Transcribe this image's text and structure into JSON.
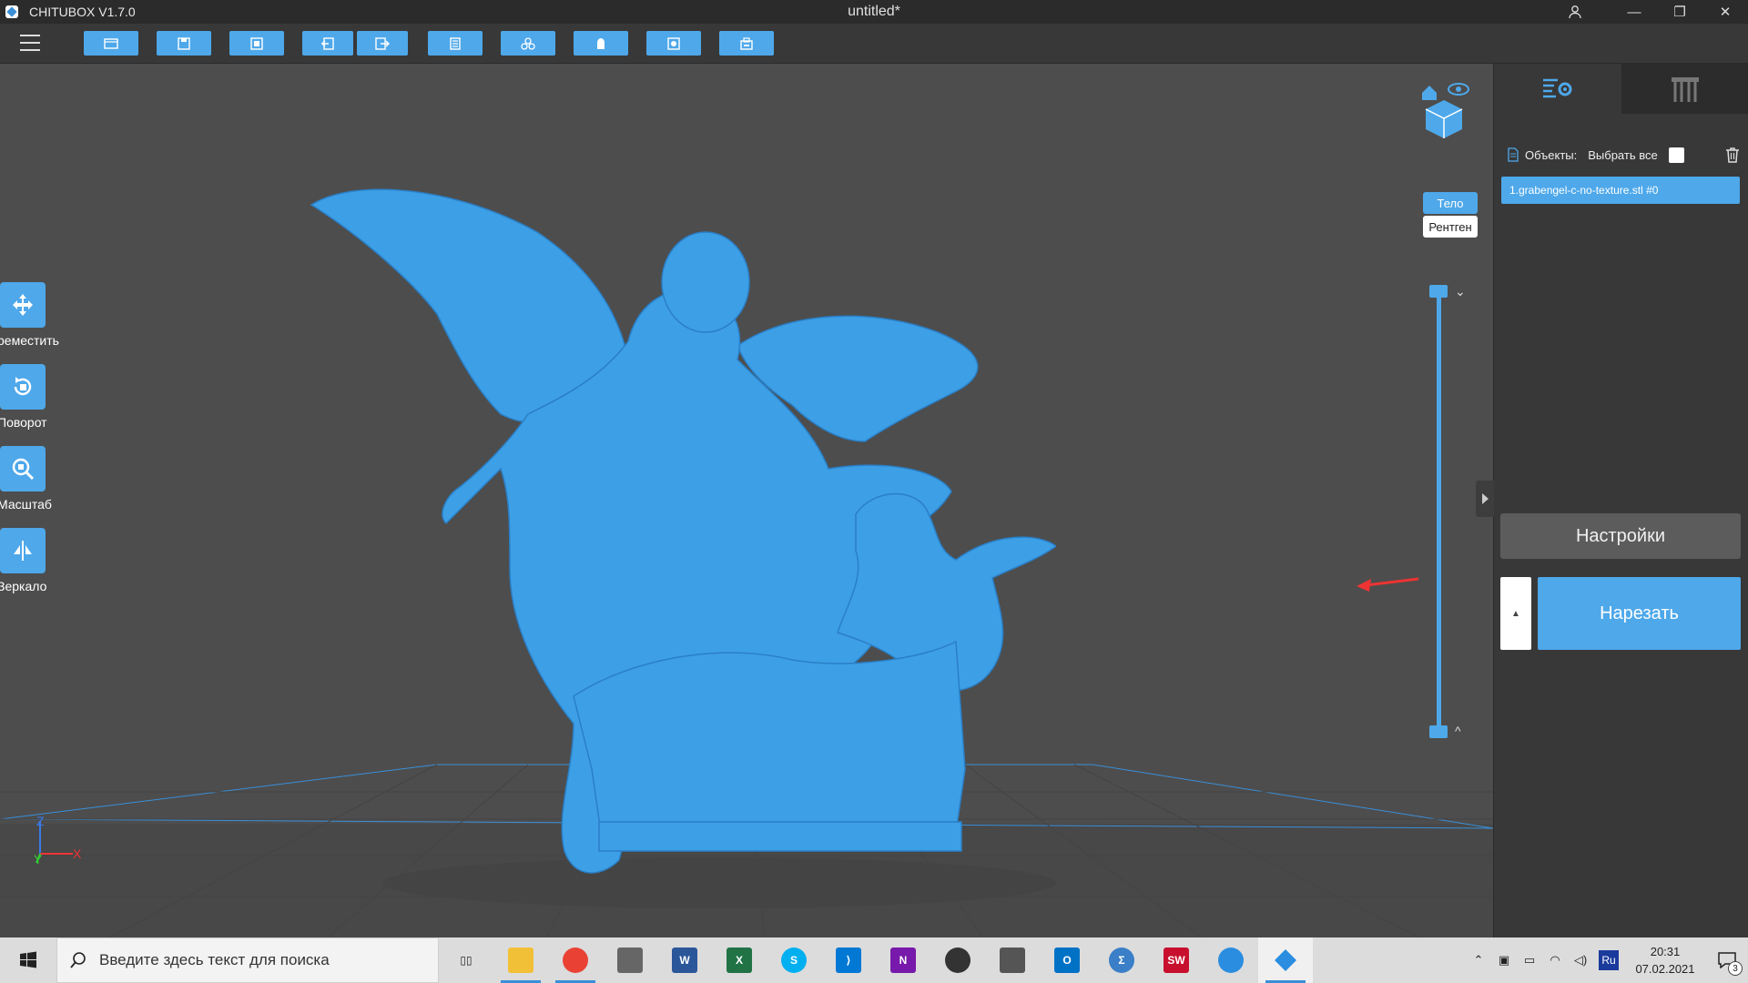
{
  "window": {
    "app_title": "CHITUBOX V1.7.0",
    "doc_title": "untitled*",
    "controls": {
      "minimize": "—",
      "maximize": "❐",
      "close": "✕"
    }
  },
  "toolbar": {
    "buttons": [
      "open-file-icon",
      "save-icon",
      "auto-layout-icon",
      "import-icon",
      "export-icon",
      "copy-icon",
      "multiply-icon",
      "hollow-icon",
      "punch-hole-icon",
      "print-icon"
    ]
  },
  "left_tools": [
    {
      "label": "реместить",
      "icon": "move-icon"
    },
    {
      "label": "Поворот",
      "icon": "rotate-icon"
    },
    {
      "label": "Масштаб",
      "icon": "scale-icon"
    },
    {
      "label": "Зеркало",
      "icon": "mirror-icon"
    }
  ],
  "view_modes": {
    "body": "Тело",
    "xray": "Рентген"
  },
  "axes": {
    "z": "Z",
    "y": "Y",
    "x": "X"
  },
  "right_panel": {
    "objects_label": "Объекты:",
    "select_all_label": "Выбрать все",
    "object_item": "1.grabengel-c-no-texture.stl #0",
    "settings_button": "Настройки",
    "slice_button": "Нарезать",
    "slice_expand": "▲"
  },
  "taskbar": {
    "search_placeholder": "Введите здесь текст для поиска",
    "lang": "Ru",
    "time": "20:31",
    "date": "07.02.2021",
    "notification_count": "3"
  },
  "colors": {
    "accent": "#4ea8ea",
    "model": "#3d9fe6",
    "viewport": "#4d4d4d",
    "panel": "#383838"
  }
}
